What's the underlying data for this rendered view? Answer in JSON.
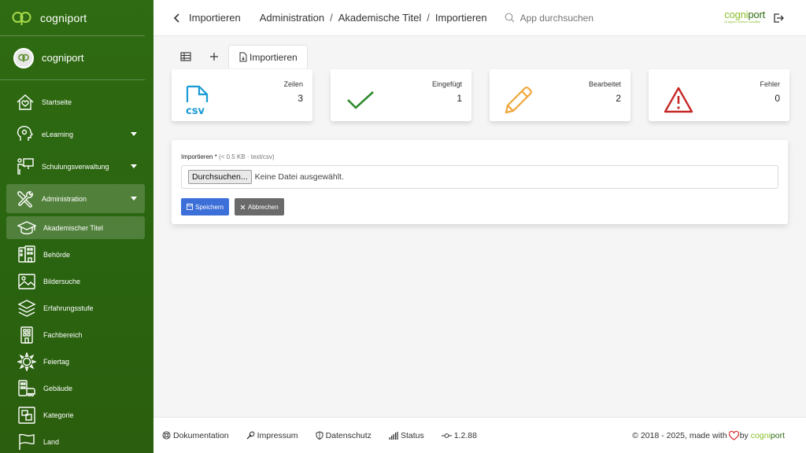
{
  "sidebar": {
    "brand": "cogniport",
    "user": "cogniport",
    "items": [
      {
        "label": "Startseite",
        "icon": "home-icon"
      },
      {
        "label": "eLearning",
        "icon": "elearning-icon"
      },
      {
        "label": "Schulungsverwaltung",
        "icon": "presenter-icon"
      },
      {
        "label": "Administration",
        "icon": "tools-icon"
      }
    ],
    "subitems": [
      {
        "label": "Akademischer Titel",
        "icon": "graduation-cap-icon"
      },
      {
        "label": "Behörde",
        "icon": "building-icon"
      },
      {
        "label": "Bildersuche",
        "icon": "image-icon"
      },
      {
        "label": "Erfahrungsstufe",
        "icon": "layers-icon"
      },
      {
        "label": "Fachbereich",
        "icon": "office-icon"
      },
      {
        "label": "Feiertag",
        "icon": "sun-icon"
      },
      {
        "label": "Gebäude",
        "icon": "buildings-icon"
      },
      {
        "label": "Kategorie",
        "icon": "category-icon"
      },
      {
        "label": "Land",
        "icon": "flag-icon"
      }
    ]
  },
  "topbar": {
    "current": "Importieren",
    "breadcrumb": [
      "Administration",
      "Akademische Titel",
      "Importieren"
    ],
    "search_placeholder": "App durchsuchen",
    "logo_a": "cogni",
    "logo_b": "port",
    "logo_tag": "Gruppen Wissen schaffen"
  },
  "tabs": {
    "active": "Importieren"
  },
  "cards": [
    {
      "title": "Zeilen",
      "value": "3",
      "icon": "csv-file-icon",
      "icon_text": "csv",
      "color": "#1a9ad6"
    },
    {
      "title": "Eingefügt",
      "value": "1",
      "icon": "check-icon",
      "color": "#2e8a2e"
    },
    {
      "title": "Bearbeitet",
      "value": "2",
      "icon": "pencil-icon",
      "color": "#f0a63a"
    },
    {
      "title": "Fehler",
      "value": "0",
      "icon": "warning-icon",
      "color": "#c62828"
    }
  ],
  "form": {
    "label": "Importieren *",
    "hint": "(< 0.5 KB · text/csv)",
    "browse": "Durchsuchen...",
    "no_file": "Keine Datei ausgewählt.",
    "save": "Speichern",
    "cancel": "Abbrechen"
  },
  "footer": {
    "links": [
      "Dokumentation",
      "Impressum",
      "Datenschutz",
      "Status",
      "1.2.88"
    ],
    "copyright": "© 2018 - 2025, made with",
    "by": "by",
    "brand_a": "cogni",
    "brand_b": "port"
  }
}
